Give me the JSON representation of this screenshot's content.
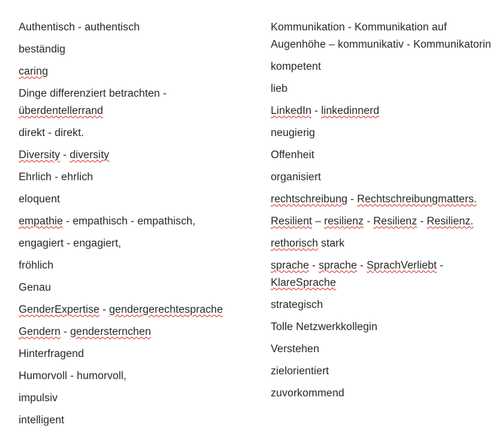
{
  "document": {
    "text_color": "#262626",
    "background_color": "#ffffff",
    "spellcheck_underline_color": "#e02f2f",
    "columns": [
      {
        "name": "left-column",
        "entries": [
          {
            "id": "authentisch",
            "text": "Authentisch - authentisch",
            "misspelled": []
          },
          {
            "id": "bestaendig",
            "text": "beständig",
            "misspelled": []
          },
          {
            "id": "caring",
            "text": "caring",
            "misspelled": [
              "caring"
            ]
          },
          {
            "id": "dinge-differenziert",
            "text": "Dinge differenziert betrachten - überdentellerrand",
            "misspelled": [
              "überdentellerrand"
            ]
          },
          {
            "id": "direkt",
            "text": "direkt - direkt.",
            "misspelled": []
          },
          {
            "id": "diversity",
            "text": "Diversity - diversity",
            "misspelled": [
              "Diversity",
              "diversity"
            ]
          },
          {
            "id": "ehrlich",
            "text": "Ehrlich - ehrlich",
            "misspelled": []
          },
          {
            "id": "eloquent",
            "text": "eloquent",
            "misspelled": []
          },
          {
            "id": "empathie",
            "text": "empathie  - empathisch - empathisch,",
            "misspelled": [
              "empathie"
            ]
          },
          {
            "id": "engagiert",
            "text": "engagiert - engagiert,",
            "misspelled": []
          },
          {
            "id": "froehlich",
            "text": "fröhlich",
            "misspelled": []
          },
          {
            "id": "genau",
            "text": "Genau",
            "misspelled": []
          },
          {
            "id": "genderexpertise",
            "text": "GenderExpertise - gendergerechtesprache",
            "misspelled": [
              "GenderExpertise",
              "gendergerechtesprache"
            ]
          },
          {
            "id": "gendern",
            "text": "Gendern - gendersternchen",
            "misspelled": [
              "Gendern",
              "gendersternchen"
            ]
          },
          {
            "id": "hinterfragend",
            "text": "Hinterfragend",
            "misspelled": []
          },
          {
            "id": "humorvoll",
            "text": "Humorvoll - humorvoll,",
            "misspelled": []
          },
          {
            "id": "impulsiv",
            "text": "impulsiv",
            "misspelled": []
          },
          {
            "id": "intelligent",
            "text": "intelligent",
            "misspelled": []
          }
        ]
      },
      {
        "name": "right-column",
        "entries": [
          {
            "id": "kommunikation",
            "text": "Kommunikation - Kommunikation auf Augenhöhe – kommunikativ - Kommunikatorin",
            "misspelled": []
          },
          {
            "id": "kompetent",
            "text": "kompetent",
            "misspelled": []
          },
          {
            "id": "lieb",
            "text": "lieb",
            "misspelled": []
          },
          {
            "id": "linkedin",
            "text": "LinkedIn - linkedinnerd",
            "misspelled": [
              "LinkedIn",
              "linkedinnerd"
            ]
          },
          {
            "id": "neugierig",
            "text": "neugierig",
            "misspelled": []
          },
          {
            "id": "offenheit",
            "text": "Offenheit",
            "misspelled": []
          },
          {
            "id": "organisiert",
            "text": "organisiert",
            "misspelled": []
          },
          {
            "id": "rechtschreibung",
            "text": "rechtschreibung - Rechtschreibungmatters.",
            "misspelled": [
              "rechtschreibung",
              "Rechtschreibungmatters."
            ]
          },
          {
            "id": "resilient",
            "text": "Resilient – resilienz - Resilienz - Resilienz.",
            "misspelled": [
              "Resilient",
              "resilienz",
              "Resilienz",
              "Resilienz."
            ]
          },
          {
            "id": "rethorisch",
            "text": "rethorisch stark",
            "misspelled": [
              "rethorisch"
            ]
          },
          {
            "id": "sprache",
            "text": "sprache - sprache  - SprachVerliebt - KlareSprache",
            "misspelled": [
              "sprache",
              "sprache",
              "SprachVerliebt",
              "KlareSprache"
            ]
          },
          {
            "id": "strategisch",
            "text": "strategisch",
            "misspelled": []
          },
          {
            "id": "tolle-netzwerkkollegin",
            "text": "Tolle Netzwerkkollegin",
            "misspelled": []
          },
          {
            "id": "verstehen",
            "text": "Verstehen",
            "misspelled": []
          },
          {
            "id": "zielorientiert",
            "text": "zielorientiert",
            "misspelled": []
          },
          {
            "id": "zuvorkommend",
            "text": "zuvorkommend",
            "misspelled": []
          }
        ]
      }
    ]
  }
}
